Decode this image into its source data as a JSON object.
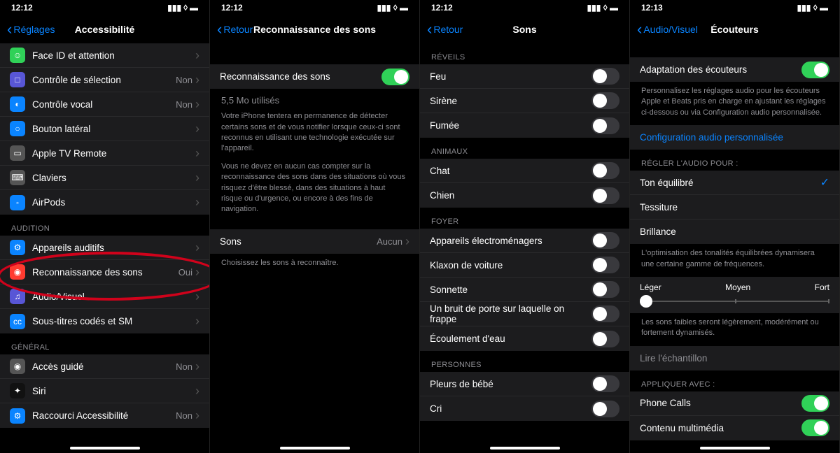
{
  "panel1": {
    "time": "12:12",
    "back": "Réglages",
    "title": "Accessibilité",
    "rows_top": [
      {
        "icon_bg": "#30d158",
        "icon": "☺",
        "label": "Face ID et attention",
        "detail": ""
      },
      {
        "icon_bg": "#5856d6",
        "icon": "□",
        "label": "Contrôle de sélection",
        "detail": "Non"
      },
      {
        "icon_bg": "#0a84ff",
        "icon": "◐",
        "label": "Contrôle vocal",
        "detail": "Non"
      },
      {
        "icon_bg": "#0a84ff",
        "icon": "○",
        "label": "Bouton latéral",
        "detail": ""
      },
      {
        "icon_bg": "#555",
        "icon": "▭",
        "label": "Apple TV Remote",
        "detail": ""
      },
      {
        "icon_bg": "#555",
        "icon": "⌨",
        "label": "Claviers",
        "detail": ""
      },
      {
        "icon_bg": "#0a84ff",
        "icon": "◦",
        "label": "AirPods",
        "detail": ""
      }
    ],
    "section_audition": "AUDITION",
    "rows_audition": [
      {
        "icon_bg": "#0a84ff",
        "icon": "⚙",
        "label": "Appareils auditifs",
        "detail": ""
      },
      {
        "icon_bg": "#ff3b30",
        "icon": "◉",
        "label": "Reconnaissance des sons",
        "detail": "Oui"
      },
      {
        "icon_bg": "#5856d6",
        "icon": "♫",
        "label": "Audio/Visuel",
        "detail": ""
      },
      {
        "icon_bg": "#0a84ff",
        "icon": "cc",
        "label": "Sous-titres codés et SM",
        "detail": ""
      }
    ],
    "section_general": "GÉNÉRAL",
    "rows_general": [
      {
        "icon_bg": "#555",
        "icon": "◉",
        "label": "Accès guidé",
        "detail": "Non"
      },
      {
        "icon_bg": "#111",
        "icon": "✦",
        "label": "Siri",
        "detail": ""
      },
      {
        "icon_bg": "#0a84ff",
        "icon": "⚙",
        "label": "Raccourci Accessibilité",
        "detail": "Non"
      }
    ]
  },
  "panel2": {
    "time": "12:12",
    "back": "Retour",
    "title": "Reconnaissance des sons",
    "toggle_label": "Reconnaissance des sons",
    "storage": "5,5 Mo utilisés",
    "desc1": "Votre iPhone tentera en permanence de détecter certains sons et de vous notifier lorsque ceux-ci sont reconnus en utilisant une technologie exécutée sur l'appareil.",
    "desc2": "Vous ne devez en aucun cas compter sur la reconnaissance des sons dans des situations où vous risquez d'être blessé, dans des situations à haut risque ou d'urgence, ou encore à des fins de navigation.",
    "sons_label": "Sons",
    "sons_value": "Aucun",
    "footer": "Choisissez les sons à reconnaître."
  },
  "panel3": {
    "time": "12:12",
    "back": "Retour",
    "title": "Sons",
    "sections": [
      {
        "header": "RÉVEILS",
        "items": [
          "Feu",
          "Sirène",
          "Fumée"
        ]
      },
      {
        "header": "ANIMAUX",
        "items": [
          "Chat",
          "Chien"
        ]
      },
      {
        "header": "FOYER",
        "items": [
          "Appareils électroménagers",
          "Klaxon de voiture",
          "Sonnette",
          "Un bruit de porte sur laquelle on frappe",
          "Écoulement d'eau"
        ]
      },
      {
        "header": "PERSONNES",
        "items": [
          "Pleurs de bébé",
          "Cri"
        ]
      }
    ]
  },
  "panel4": {
    "time": "12:13",
    "back": "Audio/Visuel",
    "title": "Écouteurs",
    "adapt_label": "Adaptation des écouteurs",
    "adapt_desc": "Personnalisez les réglages audio pour les écouteurs Apple et Beats pris en charge en ajustant les réglages ci-dessous ou via Configuration audio personnalisée.",
    "config_link": "Configuration audio personnalisée",
    "tune_header": "RÉGLER L'AUDIO POUR :",
    "tune_options": [
      "Ton équilibré",
      "Tessiture",
      "Brillance"
    ],
    "tune_desc": "L'optimisation des tonalités équilibrées dynamisera une certaine gamme de fréquences.",
    "slider_labels": [
      "Léger",
      "Moyen",
      "Fort"
    ],
    "slider_desc": "Les sons faibles seront légèrement, modérément ou fortement dynamisés.",
    "sample": "Lire l'échantillon",
    "apply_header": "APPLIQUER AVEC :",
    "apply_items": [
      {
        "label": "Phone Calls",
        "on": true
      },
      {
        "label": "Contenu multimédia",
        "on": true
      }
    ]
  }
}
